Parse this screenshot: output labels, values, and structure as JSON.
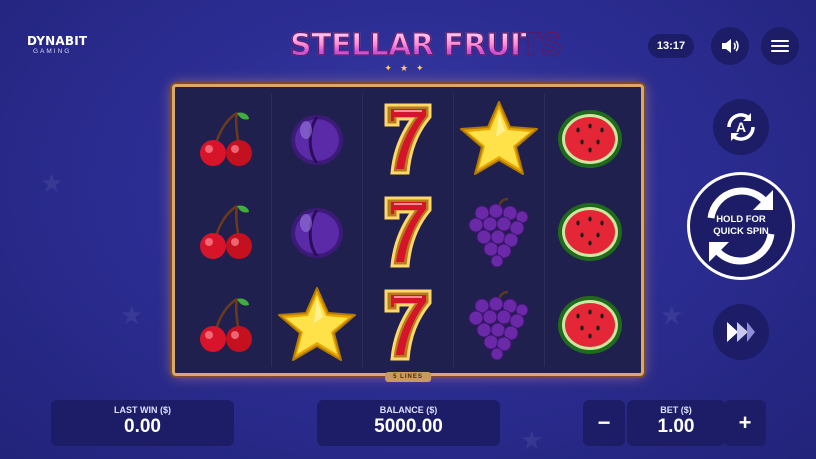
{
  "brand": {
    "line1": "DYNABIT",
    "line2": "GAMING"
  },
  "game_title": "STELLAR FRUITS",
  "clock": "13:17",
  "top_controls": {
    "sound_icon": "speaker-icon",
    "menu_icon": "hamburger-menu-icon"
  },
  "reels": [
    [
      "cherry",
      "cherry",
      "cherry"
    ],
    [
      "plum",
      "plum",
      "star"
    ],
    [
      "seven",
      "seven",
      "seven"
    ],
    [
      "star",
      "grapes",
      "grapes"
    ],
    [
      "watermelon",
      "watermelon",
      "watermelon"
    ]
  ],
  "paylines_label": "5 LINES",
  "side_controls": {
    "autoplay_icon": "autoplay-a-icon",
    "spin_label_line1": "HOLD FOR",
    "spin_label_line2": "QUICK SPIN",
    "turbo_icon": "fast-forward-icon"
  },
  "bottom_bar": {
    "last_win_label": "LAST WIN ($)",
    "last_win_value": "0.00",
    "balance_label": "BALANCE ($)",
    "balance_value": "5000.00",
    "bet_label": "BET ($)",
    "bet_value": "1.00",
    "minus": "−",
    "plus": "+"
  },
  "colors": {
    "background": "#2c2d93",
    "panel": "#1c1d66",
    "frame": "#d9a86a",
    "accent_star": "#ffd24d"
  }
}
